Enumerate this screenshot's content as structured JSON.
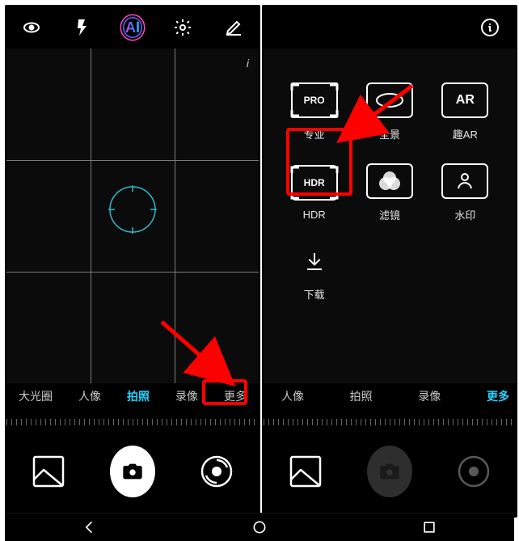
{
  "left": {
    "modes": [
      "大光圈",
      "人像",
      "拍照",
      "录像",
      "更多"
    ],
    "active_mode_index": 2,
    "highlight_mode_index": 4
  },
  "right": {
    "modes": [
      "人像",
      "拍照",
      "录像",
      "更多"
    ],
    "active_mode_index": 3,
    "tiles": [
      {
        "key": "pro",
        "icon_label": "PRO",
        "label": "专业",
        "highlight": true
      },
      {
        "key": "panorama",
        "icon_label": "",
        "label": "全景"
      },
      {
        "key": "ar",
        "icon_label": "AR",
        "label": "趣AR"
      },
      {
        "key": "hdr",
        "icon_label": "HDR",
        "label": "HDR"
      },
      {
        "key": "filter",
        "icon_label": "",
        "label": "滤镜"
      },
      {
        "key": "watermark",
        "icon_label": "",
        "label": "水印"
      },
      {
        "key": "download",
        "icon_label": "",
        "label": "下载"
      }
    ]
  },
  "colors": {
    "accent": "#26d3ff",
    "highlight": "#ff0000"
  }
}
